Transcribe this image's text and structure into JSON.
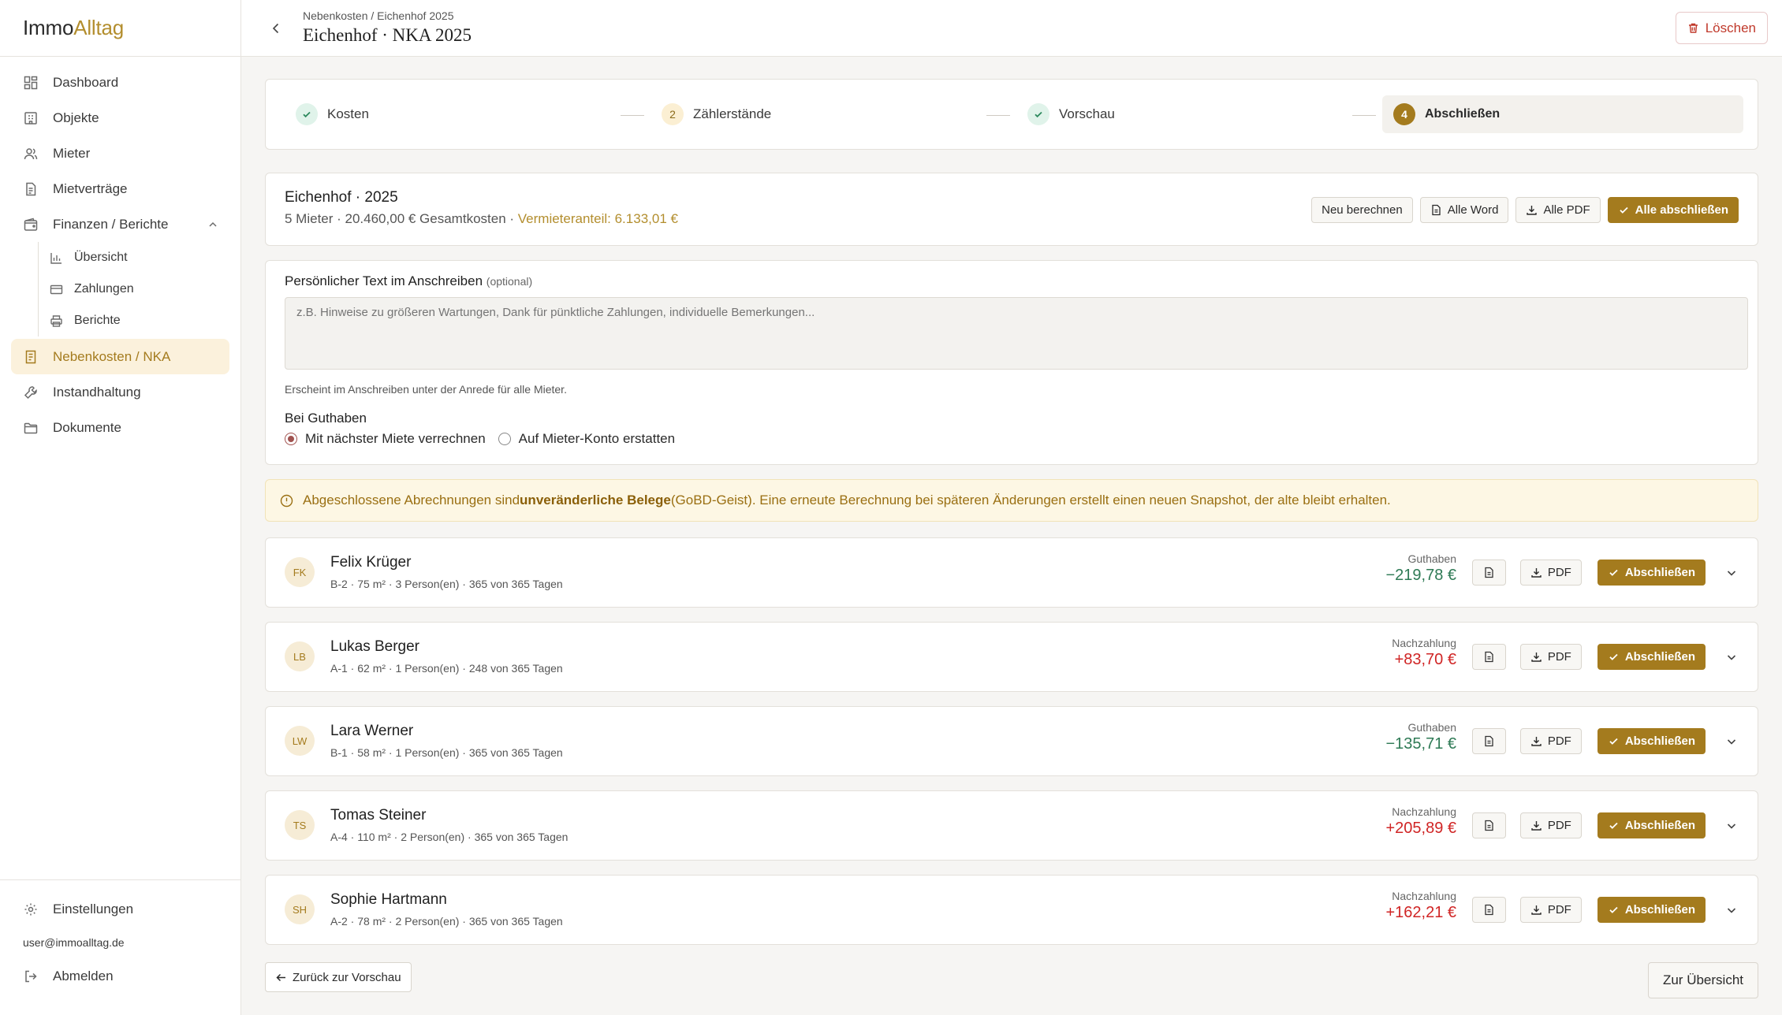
{
  "brand": {
    "part1": "Immo",
    "part2": "Alltag"
  },
  "sidebar": {
    "items": [
      {
        "label": "Dashboard",
        "icon": "dashboard-icon"
      },
      {
        "label": "Objekte",
        "icon": "building-icon"
      },
      {
        "label": "Mieter",
        "icon": "users-icon"
      },
      {
        "label": "Mietverträge",
        "icon": "document-icon"
      },
      {
        "label": "Finanzen / Berichte",
        "icon": "wallet-icon"
      }
    ],
    "sub_items": [
      {
        "label": "Übersicht",
        "icon": "bar-chart-icon"
      },
      {
        "label": "Zahlungen",
        "icon": "credit-card-icon"
      },
      {
        "label": "Berichte",
        "icon": "printer-icon"
      }
    ],
    "active": {
      "label": "Nebenkosten / NKA",
      "icon": "receipt-icon"
    },
    "more": [
      {
        "label": "Instandhaltung",
        "icon": "wrench-icon"
      },
      {
        "label": "Dokumente",
        "icon": "folder-icon"
      }
    ],
    "settings": "Einstellungen",
    "user_email": "user@immoalltag.de",
    "logout": "Abmelden"
  },
  "header": {
    "breadcrumb": "Nebenkosten / Eichenhof 2025",
    "title": "Eichenhof · NKA 2025",
    "delete_label": "Löschen"
  },
  "stepper": {
    "steps": [
      {
        "number": "",
        "label": "Kosten",
        "state": "done"
      },
      {
        "number": "2",
        "label": "Zählerstände",
        "state": "pending"
      },
      {
        "number": "",
        "label": "Vorschau",
        "state": "done"
      },
      {
        "number": "4",
        "label": "Abschließen",
        "state": "current"
      }
    ]
  },
  "summary": {
    "title": "Eichenhof · 2025",
    "meta": "5 Mieter · 20.460,00 € Gesamtkosten · ",
    "landlord_share": "Vermieteranteil: 6.133,01 €",
    "recalc": "Neu berechnen",
    "all_word": "Alle Word",
    "all_pdf": "Alle PDF",
    "finish_all": "Alle abschließen"
  },
  "letter": {
    "label": "Persönlicher Text im Anschreiben",
    "optional": "(optional)",
    "placeholder": "z.B. Hinweise zu größeren Wartungen, Dank für pünktliche Zahlungen, individuelle Bemerkungen...",
    "hint": "Erscheint im Anschreiben unter der Anrede für alle Mieter.",
    "credit_label": "Bei Guthaben",
    "option1": "Mit nächster Miete verrechnen",
    "option2": "Auf Mieter-Konto erstatten",
    "selected": "option1"
  },
  "alert": {
    "before": "Abgeschlossene Abrechnungen sind ",
    "bold": "unveränderliche Belege",
    "after": " (GoBD-Geist). Eine erneute Berechnung bei späteren Änderungen erstellt einen neuen Snapshot, der alte bleibt erhalten."
  },
  "tenants": [
    {
      "initials": "FK",
      "name": "Felix Krüger",
      "meta": "B-2 · 75 m² · 3 Person(en) · 365 von 365 Tagen",
      "kind": "Guthaben",
      "amount": "−219,78 €",
      "type": "credit"
    },
    {
      "initials": "LB",
      "name": "Lukas Berger",
      "meta": "A-1 · 62 m² · 1 Person(en) · 248 von 365 Tagen",
      "kind": "Nachzahlung",
      "amount": "+83,70 €",
      "type": "debit"
    },
    {
      "initials": "LW",
      "name": "Lara Werner",
      "meta": "B-1 · 58 m² · 1 Person(en) · 365 von 365 Tagen",
      "kind": "Guthaben",
      "amount": "−135,71 €",
      "type": "credit"
    },
    {
      "initials": "TS",
      "name": "Tomas Steiner",
      "meta": "A-4 · 110 m² · 2 Person(en) · 365 von 365 Tagen",
      "kind": "Nachzahlung",
      "amount": "+205,89 €",
      "type": "debit"
    },
    {
      "initials": "SH",
      "name": "Sophie Hartmann",
      "meta": "A-2 · 78 m² · 2 Person(en) · 365 von 365 Tagen",
      "kind": "Nachzahlung",
      "amount": "+162,21 €",
      "type": "debit"
    }
  ],
  "tenant_actions": {
    "pdf": "PDF",
    "finish": "Abschließen"
  },
  "footer": {
    "back": "Zurück zur Vorschau",
    "overview": "Zur Übersicht"
  },
  "colors": {
    "accent": "#a47b1e",
    "credit": "#2e7a55",
    "debit": "#d02525",
    "warning_bg": "#fdf7e4"
  }
}
